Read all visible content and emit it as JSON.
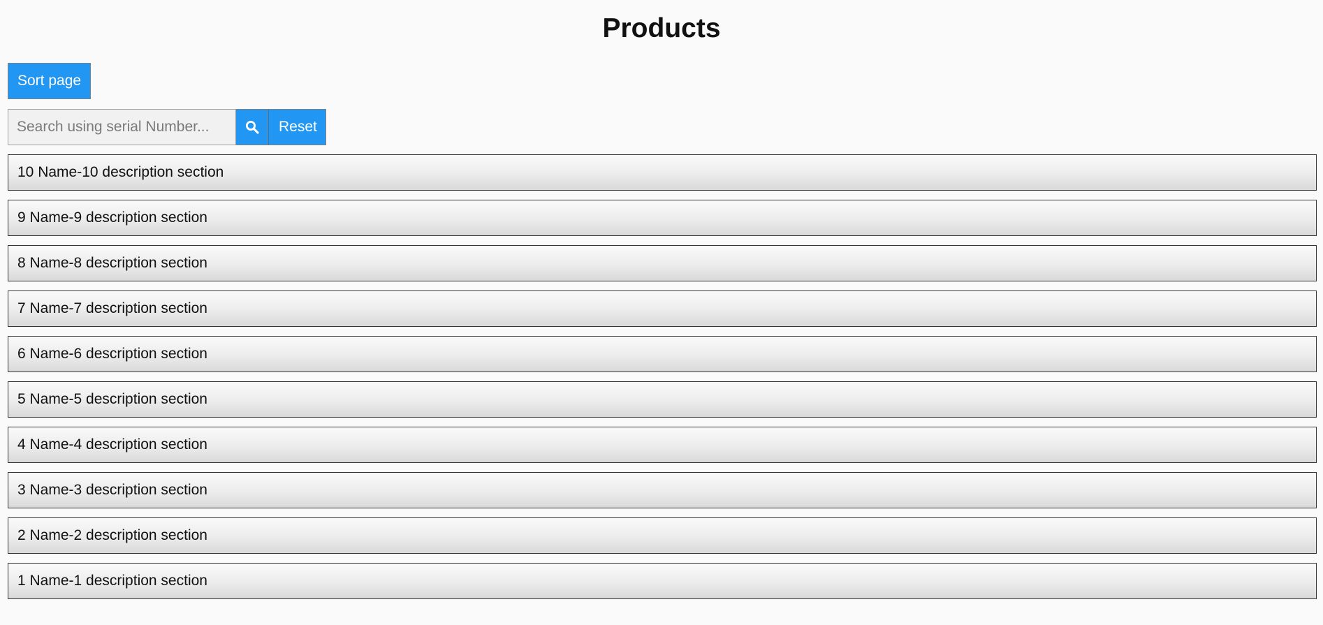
{
  "header": {
    "title": "Products"
  },
  "toolbar": {
    "sort_label": "Sort page",
    "search_placeholder": "Search using serial Number...",
    "search_value": "",
    "reset_label": "Reset"
  },
  "products": [
    {
      "label": "10 Name-10 description section"
    },
    {
      "label": "9 Name-9 description section"
    },
    {
      "label": "8 Name-8 description section"
    },
    {
      "label": "7 Name-7 description section"
    },
    {
      "label": "6 Name-6 description section"
    },
    {
      "label": "5 Name-5 description section"
    },
    {
      "label": "4 Name-4 description section"
    },
    {
      "label": "3 Name-3 description section"
    },
    {
      "label": "2 Name-2 description section"
    },
    {
      "label": "1 Name-1 description section"
    }
  ],
  "colors": {
    "accent": "#2196f3",
    "background": "#fafafa"
  },
  "icons": {
    "search": "search-icon"
  }
}
